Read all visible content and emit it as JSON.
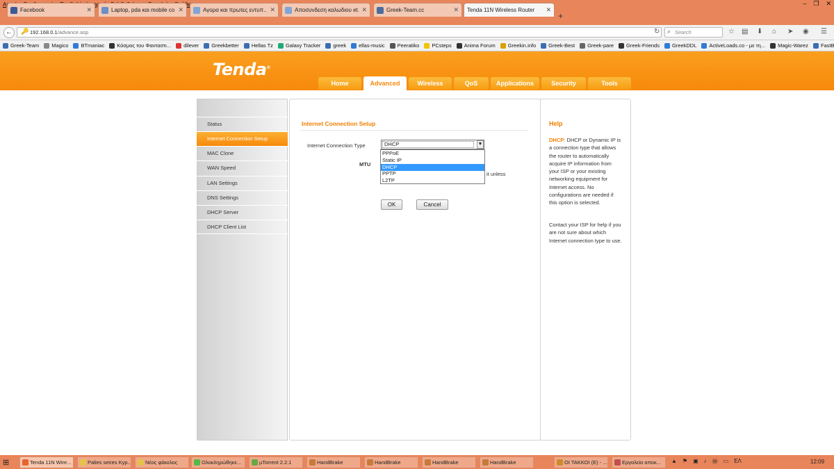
{
  "menubar": [
    "Αρχείο",
    "Επεξεργασία",
    "Προβολή",
    "Ιστορικό",
    "Σελιδοδείκτες",
    "Εργαλεία",
    "Βοήθεια"
  ],
  "window_controls": [
    "–",
    "❐",
    "✕"
  ],
  "tabs": [
    {
      "label": "Facebook",
      "color": "#3b5998"
    },
    {
      "label": "Laptop, pda και mobile co...",
      "color": "#6b8fc7"
    },
    {
      "label": "Αγορα και πρωτες εντυπ...",
      "color": "#7fa6d6"
    },
    {
      "label": "Αποσυνδεση καλωδιου et...",
      "color": "#7fa6d6"
    },
    {
      "label": "Greek-Team.cc",
      "color": "#4c6e9e"
    },
    {
      "label": "Tenda 11N Wireless Router",
      "color": "#f7890b"
    }
  ],
  "new_tab": "+",
  "nav": {
    "back": "←",
    "url_host": "192.168.0.1",
    "url_path": "/advance.asp",
    "search_placeholder": "Search"
  },
  "bookmarks": [
    {
      "label": "Greek-Team",
      "color": "#3b6db3"
    },
    {
      "label": "Magico",
      "color": "#888"
    },
    {
      "label": "BTmaniac",
      "color": "#2f7bd6"
    },
    {
      "label": "Κόσμος του Φανταστι...",
      "color": "#333"
    },
    {
      "label": "dilever",
      "color": "#d33"
    },
    {
      "label": "Greekbetter",
      "color": "#3b6db3"
    },
    {
      "label": "Hellas Tz",
      "color": "#3b6db3"
    },
    {
      "label": "Galaxy Tracker",
      "color": "#2a7"
    },
    {
      "label": "greek",
      "color": "#3b6db3"
    },
    {
      "label": "ellas-music",
      "color": "#2f7bd6"
    },
    {
      "label": "Peeratiko",
      "color": "#555"
    },
    {
      "label": "PCsteps",
      "color": "#f3c300"
    },
    {
      "label": "Anima Forum",
      "color": "#333"
    },
    {
      "label": "Greekin.info",
      "color": "#d9a200"
    },
    {
      "label": "Greek-Best",
      "color": "#3b6db3"
    },
    {
      "label": "Greek-pare",
      "color": "#666"
    },
    {
      "label": "Greek-Friends",
      "color": "#333"
    },
    {
      "label": "GreekDDL",
      "color": "#2f7bd6"
    },
    {
      "label": "ActiveLoads.co - με τη...",
      "color": "#2f7bd6"
    },
    {
      "label": "Magic-Warez",
      "color": "#333"
    },
    {
      "label": "FastBytez",
      "color": "#3b6db3"
    }
  ],
  "router": {
    "logo": "Tenda",
    "logo_mark": "®",
    "main_tabs": [
      "Home",
      "Advanced",
      "Wireless",
      "QoS",
      "Applications",
      "Security",
      "Tools"
    ],
    "active_tab": "Advanced",
    "sidebar": [
      "Status",
      "Internet Connection Setup",
      "MAC Clone",
      "WAN Speed",
      "LAN Settings",
      "DNS Settings",
      "DHCP Server",
      "DHCP Client List"
    ],
    "section_title": "Internet Connection Setup",
    "connection_type_label": "Internet Connection Type",
    "connection_type_value": "DHCP",
    "options": [
      "PPPoE",
      "Static IP",
      "DHCP",
      "PPTP",
      "L2TP"
    ],
    "selected_option": "DHCP",
    "mtu_label": "MTU",
    "mtu_hint": "it unless",
    "ok_label": "OK",
    "cancel_label": "Cancel",
    "help_title": "Help",
    "help_keyword": "DHCP",
    "help_text": ": DHCP or Dynamic IP is a connection type that allows the router to automatically acquire IP information from your ISP or your existing networking equipment for Internet access. No configurations are needed if this option is selected.",
    "help_text2": "Contact your ISP for help if you are not sure about which Internet connection type to use."
  },
  "taskbar": {
    "start": "⊞",
    "tasks": [
      {
        "label": "Tenda 11N Wire...",
        "color": "#e8632a"
      },
      {
        "label": "Palies seires Kyp...",
        "color": "#e6c24a"
      },
      {
        "label": "Νέος φάκελος",
        "color": "#e6c24a"
      },
      {
        "label": "Ολοκληρώθηκε...",
        "color": "#57b847"
      },
      {
        "label": "µTorrent 2.2.1",
        "color": "#6aa843"
      },
      {
        "label": "HandBrake",
        "color": "#c77a3a"
      },
      {
        "label": "HandBrake",
        "color": "#c77a3a"
      },
      {
        "label": "HandBrake",
        "color": "#c77a3a"
      },
      {
        "label": "HandBrake",
        "color": "#c77a3a"
      },
      {
        "label": "ΟΙ ΤΑΚΚΟΙ (E) - ...",
        "color": "#d08a2a"
      },
      {
        "label": "Εργαλείο αποκ...",
        "color": "#c0504d"
      }
    ],
    "lang": "ΕΛ",
    "clock": "12:09"
  }
}
